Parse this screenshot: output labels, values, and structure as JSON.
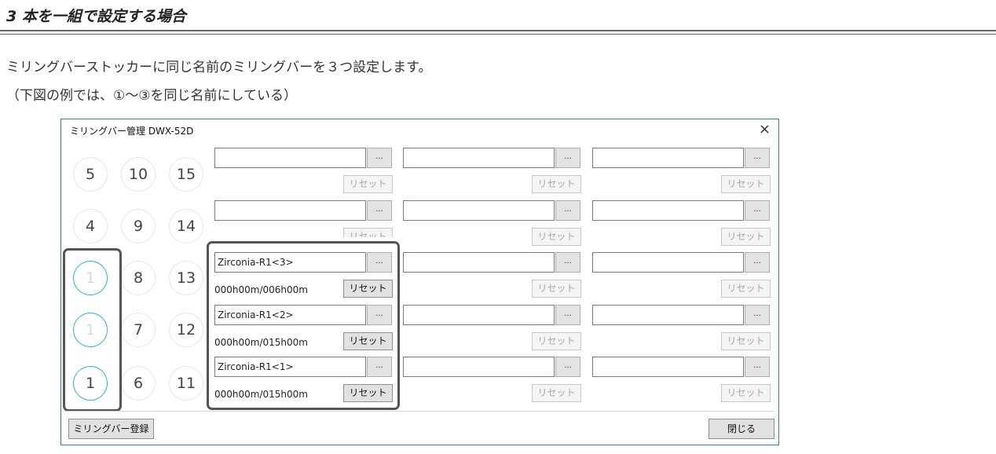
{
  "heading": "3 本を一組で設定する場合",
  "paragraphs": [
    "ミリングバーストッカーに同じ名前のミリングバーを３つ設定します。",
    "（下図の例では、①〜③を同じ名前にしている）"
  ],
  "window": {
    "title": "ミリングバー管理 DWX-52D",
    "close_glyph": "×",
    "slots": {
      "c5": "5",
      "c10": "10",
      "c15": "15",
      "c4": "4",
      "c9": "9",
      "c14": "14",
      "c3": "1",
      "c8": "8",
      "c13": "13",
      "c2": "1",
      "c7": "7",
      "c12": "12",
      "c1": "1",
      "c6": "6",
      "c11": "11"
    },
    "browse_label": "...",
    "reset_label": "リセット",
    "reset_label_partial": "リセット",
    "bars": [
      {
        "name": "Zirconia-R1<3>",
        "time": "000h00m/006h00m"
      },
      {
        "name": "Zirconia-R1<2>",
        "time": "000h00m/015h00m"
      },
      {
        "name": "Zirconia-R1<1>",
        "time": "000h00m/015h00m"
      }
    ],
    "register_button": "ミリングバー登録",
    "close_button": "閉じる",
    "accent_color": "#2ab0da",
    "border_color": "#2f7fbf"
  }
}
